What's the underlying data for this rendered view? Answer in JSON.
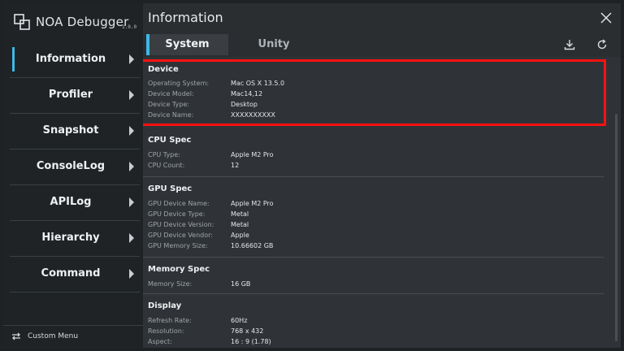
{
  "app": {
    "name": "NOA Debugger",
    "version": "1.0.0"
  },
  "colors": {
    "accent": "#3fb8e6",
    "highlight": "#ff1111"
  },
  "sidebar": {
    "items": [
      {
        "label": "Information",
        "active": true
      },
      {
        "label": "Profiler"
      },
      {
        "label": "Snapshot"
      },
      {
        "label": "ConsoleLog"
      },
      {
        "label": "APILog"
      },
      {
        "label": "Hierarchy"
      },
      {
        "label": "Command"
      }
    ],
    "custom_menu_label": "Custom Menu"
  },
  "header": {
    "title": "Information"
  },
  "tabs": [
    {
      "label": "System",
      "selected": true
    },
    {
      "label": "Unity"
    }
  ],
  "toolbar_icons": [
    "download-icon",
    "refresh-icon"
  ],
  "sections": {
    "device": {
      "title": "Device",
      "rows": [
        {
          "k": "Operating System:",
          "v": "Mac OS X 13.5.0"
        },
        {
          "k": "Device Model:",
          "v": "Mac14,12"
        },
        {
          "k": "Device Type:",
          "v": "Desktop"
        },
        {
          "k": "Device Name:",
          "v": "XXXXXXXXXX"
        }
      ]
    },
    "cpu": {
      "title": "CPU Spec",
      "rows": [
        {
          "k": "CPU Type:",
          "v": "Apple M2 Pro"
        },
        {
          "k": "CPU Count:",
          "v": "12"
        }
      ]
    },
    "gpu": {
      "title": "GPU Spec",
      "rows": [
        {
          "k": "GPU Device Name:",
          "v": "Apple M2 Pro"
        },
        {
          "k": "GPU Device Type:",
          "v": "Metal"
        },
        {
          "k": "GPU Device Version:",
          "v": "Metal"
        },
        {
          "k": "GPU Device Vendor:",
          "v": "Apple"
        },
        {
          "k": "GPU Memory Size:",
          "v": "10.66602 GB"
        }
      ]
    },
    "memory": {
      "title": "Memory Spec",
      "rows": [
        {
          "k": "Memory Size:",
          "v": "16 GB"
        }
      ]
    },
    "display": {
      "title": "Display",
      "rows": [
        {
          "k": "Refresh Rate:",
          "v": "60Hz"
        },
        {
          "k": "Resolution:",
          "v": "768 x 432"
        },
        {
          "k": "Aspect:",
          "v": "16 : 9 (1.78)"
        }
      ]
    }
  }
}
